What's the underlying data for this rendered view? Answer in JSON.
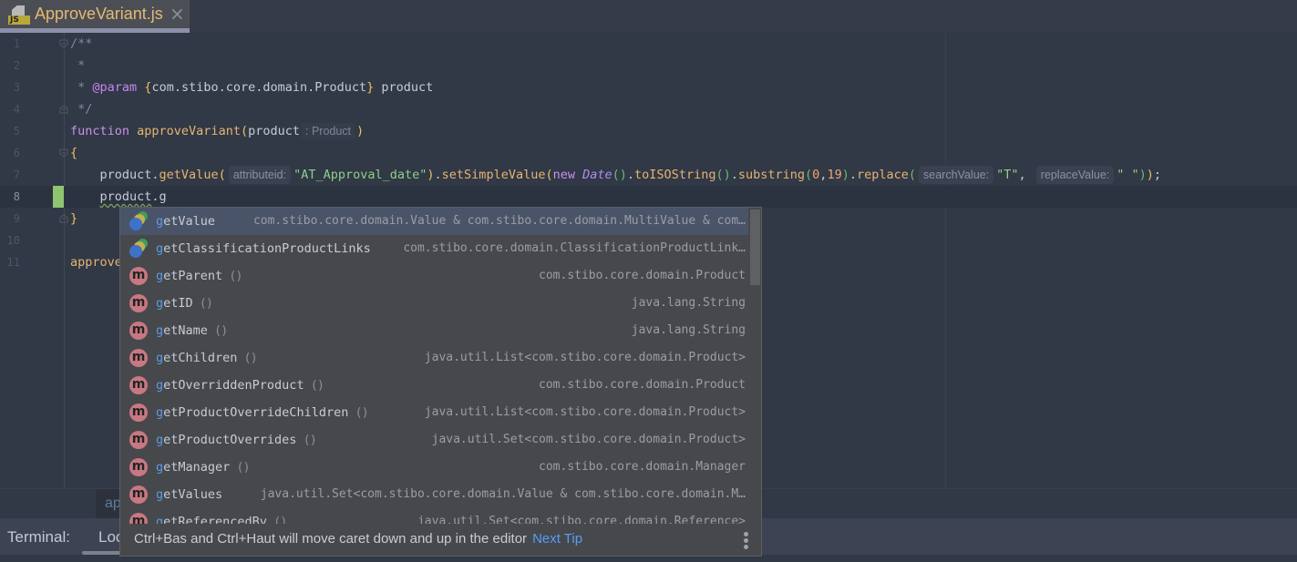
{
  "tab": {
    "title": "ApproveVariant.js",
    "icon": "js-file-icon",
    "badge": "JS"
  },
  "editor": {
    "line_numbers": [
      "1",
      "2",
      "3",
      "4",
      "5",
      "6",
      "7",
      "8",
      "9",
      "10",
      "11"
    ],
    "current_line": 8,
    "lines": {
      "l1": "/**",
      "l2": " *",
      "l3_star": " * ",
      "l3_tag": "@param",
      "l3_open": " {",
      "l3_type": "com.stibo.core.domain.Product",
      "l3_close": "}",
      "l3_name": " product",
      "l4": " */",
      "l5_kw": "function",
      "l5_fn": " approveVariant",
      "l5_open": "(",
      "l5_param": "product",
      "l5_hint": ": Product",
      "l5_close": ")",
      "l6": "{",
      "l7_obj": "    product.",
      "l7_fn1": "getValue",
      "l7_p1": "(",
      "l7_hint1": "attributeid:",
      "l7_str1": "\"AT_Approval_date\"",
      "l7_c1": ").",
      "l7_fn2": "setSimpleValue",
      "l7_p2": "(",
      "l7_new": "new ",
      "l7_date": "Date",
      "l7_p3": "()",
      "l7_dot1": ".",
      "l7_fn3": "toISOString",
      "l7_p4": "()",
      "l7_dot2": ".",
      "l7_fn4": "substring",
      "l7_p5": "(",
      "l7_n1": "0",
      "l7_comma": ",",
      "l7_n2": "19",
      "l7_p6": ")",
      "l7_dot3": ".",
      "l7_fn5": "replace",
      "l7_p7": "(",
      "l7_hint2": "searchValue:",
      "l7_str2": "\"T\"",
      "l7_comma2": ", ",
      "l7_hint3": "replaceValue:",
      "l7_str3": "\" \"",
      "l7_end1": ")",
      "l7_end2": ")",
      "l7_semi": ";",
      "l8_obj": "product",
      "l8_rest": ".g",
      "l9": "}",
      "l11": "approve"
    }
  },
  "completion": {
    "typed_prefix": "g",
    "items": [
      {
        "icon": "property-icon",
        "match": "g",
        "rest": "etValue",
        "parens": "",
        "type": "com.stibo.core.domain.Value & com.stibo.core.domain.MultiValue & com…",
        "selected": true
      },
      {
        "icon": "property-icon",
        "match": "g",
        "rest": "etClassificationProductLinks",
        "parens": "",
        "type": "com.stibo.core.domain.ClassificationProductLink…"
      },
      {
        "icon": "method-icon",
        "match": "g",
        "rest": "etParent",
        "parens": "()",
        "type": "com.stibo.core.domain.Product"
      },
      {
        "icon": "method-icon",
        "match": "g",
        "rest": "etID",
        "parens": "()",
        "type": "java.lang.String"
      },
      {
        "icon": "method-icon",
        "match": "g",
        "rest": "etName",
        "parens": "()",
        "type": "java.lang.String"
      },
      {
        "icon": "method-icon",
        "match": "g",
        "rest": "etChildren",
        "parens": "()",
        "type": "java.util.List<com.stibo.core.domain.Product>"
      },
      {
        "icon": "method-icon",
        "match": "g",
        "rest": "etOverriddenProduct",
        "parens": "()",
        "type": "com.stibo.core.domain.Product"
      },
      {
        "icon": "method-icon",
        "match": "g",
        "rest": "etProductOverrideChildren",
        "parens": "()",
        "type": "java.util.List<com.stibo.core.domain.Product>"
      },
      {
        "icon": "method-icon",
        "match": "g",
        "rest": "etProductOverrides",
        "parens": "()",
        "type": "java.util.Set<com.stibo.core.domain.Product>"
      },
      {
        "icon": "method-icon",
        "match": "g",
        "rest": "etManager",
        "parens": "()",
        "type": "com.stibo.core.domain.Manager"
      },
      {
        "icon": "method-icon",
        "match": "g",
        "rest": "etValues",
        "parens": "",
        "type": "java.util.Set<com.stibo.core.domain.Value & com.stibo.core.domain.M…"
      },
      {
        "icon": "method-icon",
        "match": "g",
        "rest": "etReferencedBy",
        "parens": "()",
        "type": "java.util.Set<com.stibo.core.domain.Reference>"
      }
    ],
    "method_icon_letter": "m",
    "tip_text": "Ctrl+Bas and Ctrl+Haut will move caret down and up in the editor",
    "tip_link": "Next Tip"
  },
  "breadcrumb": {
    "text": "ap"
  },
  "terminal": {
    "label": "Terminal:",
    "tab": "Loc"
  },
  "colors": {
    "editor_bg": "#313846",
    "popup_bg": "#46484b",
    "selection_bg": "#4a5468",
    "match_highlight": "#5b9be6",
    "link": "#589df6",
    "change_marker": "#8fc470"
  }
}
